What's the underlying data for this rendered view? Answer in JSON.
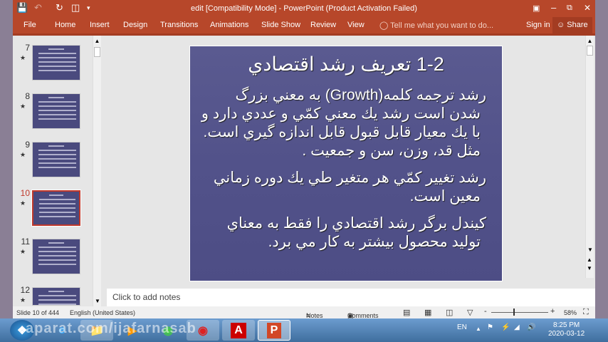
{
  "window": {
    "title": "edit [Compatibility Mode] - PowerPoint (Product Activation Failed)"
  },
  "ribbon": {
    "tabs": [
      "File",
      "Home",
      "Insert",
      "Design",
      "Transitions",
      "Animations",
      "Slide Show",
      "Review",
      "View"
    ],
    "tell_me": "Tell me what you want to do...",
    "sign_in": "Sign in",
    "share": "Share"
  },
  "thumbnails": [
    {
      "num": "7"
    },
    {
      "num": "8"
    },
    {
      "num": "9"
    },
    {
      "num": "10"
    },
    {
      "num": "11"
    },
    {
      "num": "12"
    }
  ],
  "slide": {
    "title": "1-2  تعريف رشد اقتصادي",
    "lines": [
      "رشد ترجمه كلمه(Growth) به معني  بزرگ",
      "شدن است رشد يك معني كمّي و عددي دارد و",
      "با يك معيار قابل قبول قابل اندازه گيري است.",
      "مثل قد، وزن، سن و جمعيت .",
      "رشد تغيير كمّي هر متغير طي  يك  دوره  زماني",
      "معين است.",
      "كيندل برگر رشد اقتصادي را فقط به معناي",
      "توليد محصول بيشتر به كار مي برد."
    ]
  },
  "notes": {
    "placeholder": "Click to add notes"
  },
  "status": {
    "slide": "Slide 10 of 444",
    "language": "English (United States)",
    "notes": "Notes",
    "comments": "Comments",
    "zoom": "58%",
    "zoom_value": 58
  },
  "taskbar": {
    "lang": "EN",
    "time": "8:25 PM",
    "date": "2020-03-12"
  },
  "watermark": "aparat.com/ijafarnasab"
}
